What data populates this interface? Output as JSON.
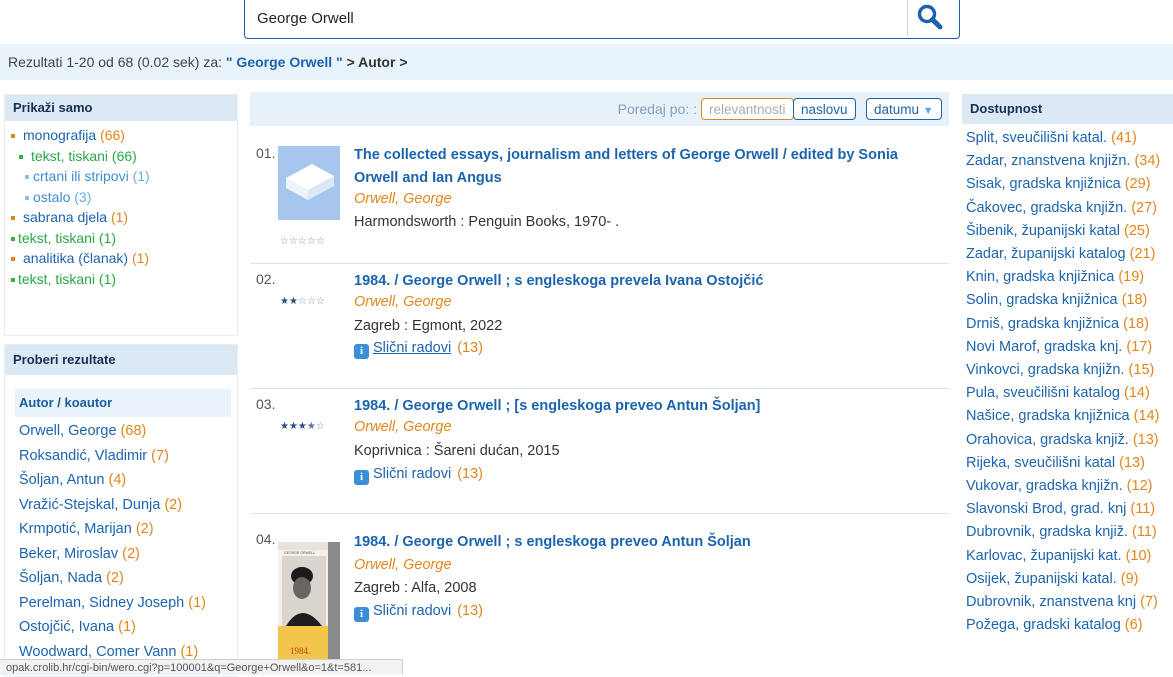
{
  "search": {
    "value": "George Orwell",
    "button_icon": "search-icon"
  },
  "results_bar": {
    "prefix": "Rezultati 1-20 od 68 (0.02 sek) za:",
    "query": "\" George Orwell \"",
    "crumb": "> Autor >"
  },
  "prikazi": {
    "title": "Prikaži samo",
    "items": [
      {
        "label": "monografija",
        "count": "(66)"
      },
      {
        "label": "tekst, tiskani",
        "count": "(66)"
      },
      {
        "label": "crtani ili stripovi",
        "count": "(1)"
      },
      {
        "label": "ostalo",
        "count": "(3)"
      },
      {
        "label": "sabrana djela",
        "count": "(1)"
      },
      {
        "label": "tekst, tiskani",
        "count": "(1)"
      },
      {
        "label": "analitika (članak)",
        "count": "(1)"
      },
      {
        "label": "tekst, tiskani",
        "count": "(1)"
      }
    ]
  },
  "proberi": {
    "title": "Proberi rezultate",
    "section": "Autor / koautor",
    "authors": [
      {
        "name": "Orwell, George",
        "count": "(68)"
      },
      {
        "name": "Roksandić, Vladimir",
        "count": "(7)"
      },
      {
        "name": "Šoljan, Antun",
        "count": "(4)"
      },
      {
        "name": "Vražić-Stejskal, Dunja",
        "count": "(2)"
      },
      {
        "name": "Krmpotić, Marijan",
        "count": "(2)"
      },
      {
        "name": "Beker, Miroslav",
        "count": "(2)"
      },
      {
        "name": "Šoljan, Nada",
        "count": "(2)"
      },
      {
        "name": "Perelman, Sidney Joseph",
        "count": "(1)"
      },
      {
        "name": "Ostojčić, Ivana",
        "count": "(1)"
      },
      {
        "name": "Woodward, Comer Vann",
        "count": "(1)"
      }
    ]
  },
  "sort": {
    "label": "Poredaj po: :",
    "options": [
      "relevantnosti",
      "naslovu",
      "datumu"
    ],
    "selected": "relevantnosti"
  },
  "records": [
    {
      "num": "01.",
      "title": "The collected essays, journalism and letters of George Orwell / edited by Sonia Orwell and Ian Angus",
      "author": "Orwell, George",
      "pub": "Harmondsworth : Penguin Books, 1970- .",
      "rating": 0,
      "similar": null,
      "similar_count": null
    },
    {
      "num": "02.",
      "title": "1984. / George Orwell ; s engleskoga prevela Ivana Ostojčić",
      "author": "Orwell, George",
      "pub": "Zagreb : Egmont, 2022",
      "rating": 2,
      "similar": "Slični radovi",
      "similar_count": "(13)"
    },
    {
      "num": "03.",
      "title": "1984. / George Orwell ; [s engleskoga preveo Antun Šoljan]",
      "author": "Orwell, George",
      "pub": "Koprivnica : Šareni dućan, 2015",
      "rating": 3.5,
      "similar": "Slični radovi",
      "similar_count": "(13)"
    },
    {
      "num": "04.",
      "title": "1984. / George Orwell ; s engleskoga preveo Antun Šoljan",
      "author": "Orwell, George",
      "pub": "Zagreb : Alfa, 2008",
      "rating": null,
      "similar": "Slični radovi",
      "similar_count": "(13)"
    }
  ],
  "book_cover": {
    "top_text": "GEORGE ORWELL",
    "title": "1984."
  },
  "dostupnost": {
    "title": "Dostupnost",
    "items": [
      {
        "name": "Split, sveučilišni katal.",
        "count": "(41)"
      },
      {
        "name": "Zadar, znanstvena knjižn.",
        "count": "(34)"
      },
      {
        "name": "Sisak, gradska knjižnica",
        "count": "(29)"
      },
      {
        "name": "Čakovec, gradska knjižn.",
        "count": "(27)"
      },
      {
        "name": "Šibenik, županijski katal",
        "count": "(25)"
      },
      {
        "name": "Zadar, županijski katalog",
        "count": "(21)"
      },
      {
        "name": "Knin, gradska knjižnica",
        "count": "(19)"
      },
      {
        "name": "Solin, gradska knjižnica",
        "count": "(18)"
      },
      {
        "name": "Drniš, gradska knjižnica",
        "count": "(18)"
      },
      {
        "name": "Novi Marof, gradska knj.",
        "count": "(17)"
      },
      {
        "name": "Vinkovci, gradska knjižn.",
        "count": "(15)"
      },
      {
        "name": "Pula, sveučilišni katalog",
        "count": "(14)"
      },
      {
        "name": "Našice, gradska knjižnica",
        "count": "(14)"
      },
      {
        "name": "Orahovica, gradska knjiž.",
        "count": "(13)"
      },
      {
        "name": "Rijeka, sveučilišni katal",
        "count": "(13)"
      },
      {
        "name": "Vukovar, gradska knjižn.",
        "count": "(12)"
      },
      {
        "name": "Slavonski Brod, grad. knj",
        "count": "(11)"
      },
      {
        "name": "Dubrovnik, gradska knjiž.",
        "count": "(11)"
      },
      {
        "name": "Karlovac, županijski kat.",
        "count": "(10)"
      },
      {
        "name": "Osijek, županijski katal.",
        "count": "(9)"
      },
      {
        "name": "Dubrovnik, znanstvena knj",
        "count": "(7)"
      },
      {
        "name": "Požega, gradski katalog",
        "count": "(6)"
      }
    ]
  },
  "status_url": "opak.crolib.hr/cgi-bin/wero.cgi?p=100001&q=George+Orwell&o=1&t=581...",
  "colors": {
    "link": "#1b64ad",
    "count": "#e0861c",
    "panel": "#dbe9f5",
    "band": "#e9f3fb"
  }
}
